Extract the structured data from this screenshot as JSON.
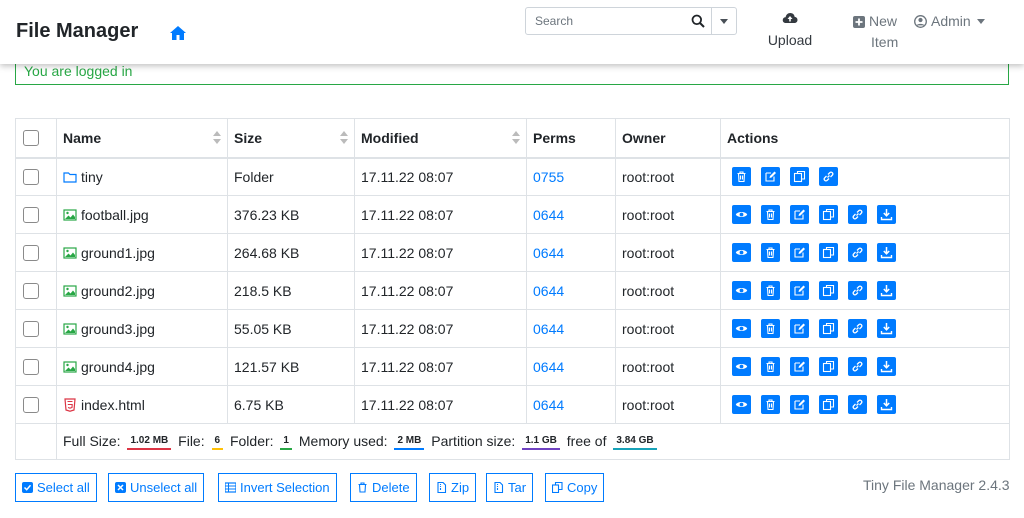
{
  "header": {
    "brand": "File Manager",
    "search_placeholder": "Search",
    "upload_label": "Upload",
    "new_item_line1": "New",
    "new_item_line2": "Item",
    "admin_label": "Admin"
  },
  "alert": {
    "message": "You are logged in"
  },
  "table": {
    "columns": {
      "name": "Name",
      "size": "Size",
      "modified": "Modified",
      "perms": "Perms",
      "owner": "Owner",
      "actions": "Actions"
    },
    "rows": [
      {
        "name": "tiny",
        "size": "Folder",
        "modified": "17.11.22 08:07",
        "perms": "0755",
        "owner": "root:root"
      },
      {
        "name": "football.jpg",
        "size": "376.23 KB",
        "modified": "17.11.22 08:07",
        "perms": "0644",
        "owner": "root:root"
      },
      {
        "name": "ground1.jpg",
        "size": "264.68 KB",
        "modified": "17.11.22 08:07",
        "perms": "0644",
        "owner": "root:root"
      },
      {
        "name": "ground2.jpg",
        "size": "218.5 KB",
        "modified": "17.11.22 08:07",
        "perms": "0644",
        "owner": "root:root"
      },
      {
        "name": "ground3.jpg",
        "size": "55.05 KB",
        "modified": "17.11.22 08:07",
        "perms": "0644",
        "owner": "root:root"
      },
      {
        "name": "ground4.jpg",
        "size": "121.57 KB",
        "modified": "17.11.22 08:07",
        "perms": "0644",
        "owner": "root:root"
      },
      {
        "name": "index.html",
        "size": "6.75 KB",
        "modified": "17.11.22 08:07",
        "perms": "0644",
        "owner": "root:root"
      }
    ]
  },
  "summary": {
    "full_size_label": "Full Size:",
    "full_size": "1.02 MB",
    "file_label": "File:",
    "file_count": "6",
    "folder_label": "Folder:",
    "folder_count": "1",
    "memory_label": "Memory used:",
    "memory": "2 MB",
    "partition_label": "Partition size:",
    "partition": "1.1 GB",
    "free_label": "free of",
    "free_total": "3.84 GB"
  },
  "buttons": {
    "select_all": "Select all",
    "unselect_all": "Unselect all",
    "invert": "Invert Selection",
    "delete": "Delete",
    "zip": "Zip",
    "tar": "Tar",
    "copy": "Copy"
  },
  "version": "Tiny File Manager 2.4.3",
  "colors": {
    "accent": "#007bff",
    "success": "#28a745",
    "badge_size": "#dc3545",
    "badge_file": "#ffc107",
    "badge_folder": "#28a745",
    "badge_memory": "#007bff",
    "badge_partition": "#6f42c1",
    "badge_free": "#17a2b8"
  }
}
